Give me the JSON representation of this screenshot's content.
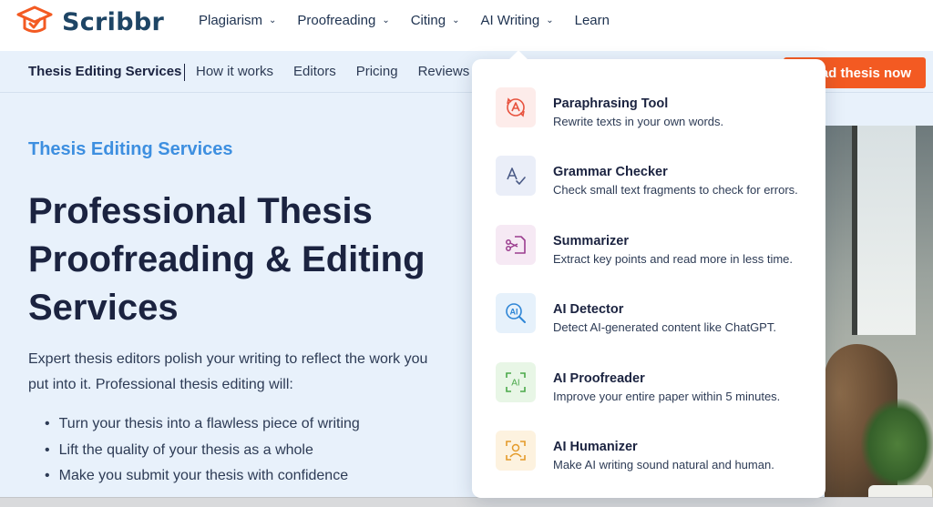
{
  "brand": {
    "name": "Scribbr",
    "accent": "#f35a22"
  },
  "top_nav": {
    "items": [
      {
        "label": "Plagiarism",
        "has_dropdown": true
      },
      {
        "label": "Proofreading",
        "has_dropdown": true
      },
      {
        "label": "Citing",
        "has_dropdown": true
      },
      {
        "label": "AI Writing",
        "has_dropdown": true
      },
      {
        "label": "Learn",
        "has_dropdown": false
      }
    ]
  },
  "sub_nav": {
    "title": "Thesis Editing Services",
    "links": [
      "How it works",
      "Editors",
      "Pricing",
      "Reviews"
    ],
    "cta_label": "ad thesis now"
  },
  "hero": {
    "eyebrow": "Thesis Editing Services",
    "headline_lines": [
      "Professional Thesis",
      "Proofreading & Editing",
      "Services"
    ],
    "intro_lines": [
      "Expert thesis editors polish your writing to reflect the work you",
      "put into it. Professional thesis editing will:"
    ],
    "bullets": [
      "Turn your thesis into a flawless piece of writing",
      "Lift the quality of your thesis as a whole",
      "Make you submit your thesis with confidence"
    ]
  },
  "ai_writing_menu": {
    "items": [
      {
        "title": "Paraphrasing Tool",
        "desc": "Rewrite texts in your own words.",
        "icon": "paraphrase-icon",
        "color": "#e8533f",
        "bg": "#fdecea"
      },
      {
        "title": "Grammar Checker",
        "desc": "Check small text fragments to check for errors.",
        "icon": "grammar-check-icon",
        "color": "#4a5a86",
        "bg": "#eaeef8"
      },
      {
        "title": "Summarizer",
        "desc": "Extract key points and read more in less time.",
        "icon": "summarizer-icon",
        "color": "#9b3d8f",
        "bg": "#f6e9f4"
      },
      {
        "title": "AI Detector",
        "desc": "Detect AI-generated content like ChatGPT.",
        "icon": "ai-detector-icon",
        "color": "#2f86d6",
        "bg": "#e6f1fb"
      },
      {
        "title": "AI Proofreader",
        "desc": "Improve your entire paper within 5 minutes.",
        "icon": "ai-proofreader-icon",
        "color": "#4aa84a",
        "bg": "#e8f6e6"
      },
      {
        "title": "AI Humanizer",
        "desc": "Make AI writing sound natural and human.",
        "icon": "ai-humanizer-icon",
        "color": "#e49a2a",
        "bg": "#fdf2df"
      }
    ]
  }
}
